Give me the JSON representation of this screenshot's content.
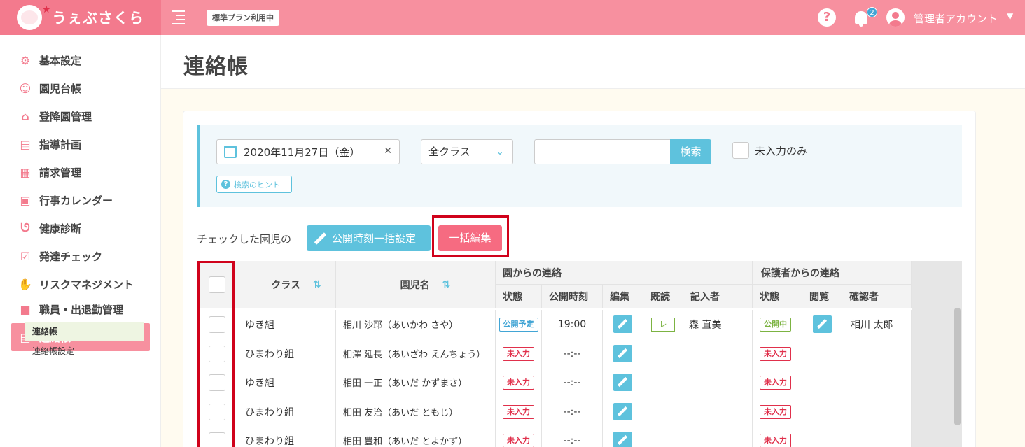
{
  "header": {
    "logo_text": "うぇぶさくら",
    "plan_badge": "標準プラン利用中",
    "notification_count": "2",
    "user_name": "管理者アカウント"
  },
  "sidebar": {
    "items": [
      {
        "label": "基本設定",
        "icon": "gear-icon"
      },
      {
        "label": "園児台帳",
        "icon": "child-face-icon"
      },
      {
        "label": "登降園管理",
        "icon": "school-building-icon"
      },
      {
        "label": "指導計画",
        "icon": "notebook-icon"
      },
      {
        "label": "請求管理",
        "icon": "calculator-icon"
      },
      {
        "label": "行事カレンダー",
        "icon": "calendar-clock-icon"
      },
      {
        "label": "健康診断",
        "icon": "stethoscope-icon"
      },
      {
        "label": "発達チェック",
        "icon": "checklist-icon"
      },
      {
        "label": "リスクマネジメント",
        "icon": "hands-icon"
      },
      {
        "label": "職員・出退勤管理",
        "icon": "briefcase-icon"
      },
      {
        "label": "連絡帳",
        "icon": "notebook-icon"
      }
    ],
    "sub_items": [
      "連絡帳",
      "連絡帳設定"
    ]
  },
  "page": {
    "title": "連絡帳"
  },
  "filter": {
    "date": "2020年11月27日（金）",
    "class_select": "全クラス",
    "search_placeholder": "",
    "search_button": "検索",
    "only_empty_label": "未入力のみ",
    "hint_label": "検索のヒント"
  },
  "actions": {
    "label": "チェックした園児の",
    "publish_button": "公開時刻一括設定",
    "bulk_edit_button": "一括編集"
  },
  "table": {
    "headers": {
      "class": "クラス",
      "name": "園児名",
      "from_school": "園からの連絡",
      "status": "状態",
      "publish_time": "公開時刻",
      "edit": "編集",
      "read": "既読",
      "writer": "記入者",
      "from_parent": "保護者からの連絡",
      "parent_status": "状態",
      "view": "閲覧",
      "confirmer": "確認者"
    },
    "rows": [
      {
        "class": "ゆき組",
        "name": "相川 沙耶（あいかわ さや）",
        "status": "公開予定",
        "status_color": "blue",
        "time": "19:00",
        "read": "レ",
        "writer": "森 直美",
        "parent_status": "公開中",
        "parent_color": "green",
        "viewable": true,
        "confirmer": "相川 太郎"
      },
      {
        "class": "ひまわり組",
        "name": "相澤 延長（あいざわ えんちょう）",
        "status": "未入力",
        "status_color": "red",
        "time": "--:--",
        "read": "",
        "writer": "",
        "parent_status": "未入力",
        "parent_color": "red",
        "viewable": false,
        "confirmer": ""
      },
      {
        "class": "ゆき組",
        "name": "相田 一正（あいだ かずまさ）",
        "status": "未入力",
        "status_color": "red",
        "time": "--:--",
        "read": "",
        "writer": "",
        "parent_status": "未入力",
        "parent_color": "red",
        "viewable": false,
        "confirmer": ""
      },
      {
        "class": "ひまわり組",
        "name": "相田 友治（あいだ ともじ）",
        "status": "未入力",
        "status_color": "red",
        "time": "--:--",
        "read": "",
        "writer": "",
        "parent_status": "未入力",
        "parent_color": "red",
        "viewable": false,
        "confirmer": ""
      },
      {
        "class": "ひまわり組",
        "name": "相田 豊和（あいだ とよかず）",
        "status": "未入力",
        "status_color": "red",
        "time": "--:--",
        "read": "",
        "writer": "",
        "parent_status": "未入力",
        "parent_color": "red",
        "viewable": false,
        "confirmer": ""
      }
    ]
  },
  "colors": {
    "brand_pink": "#f7909f",
    "accent_blue": "#5ec2dd",
    "highlight_red": "#d0021b"
  }
}
